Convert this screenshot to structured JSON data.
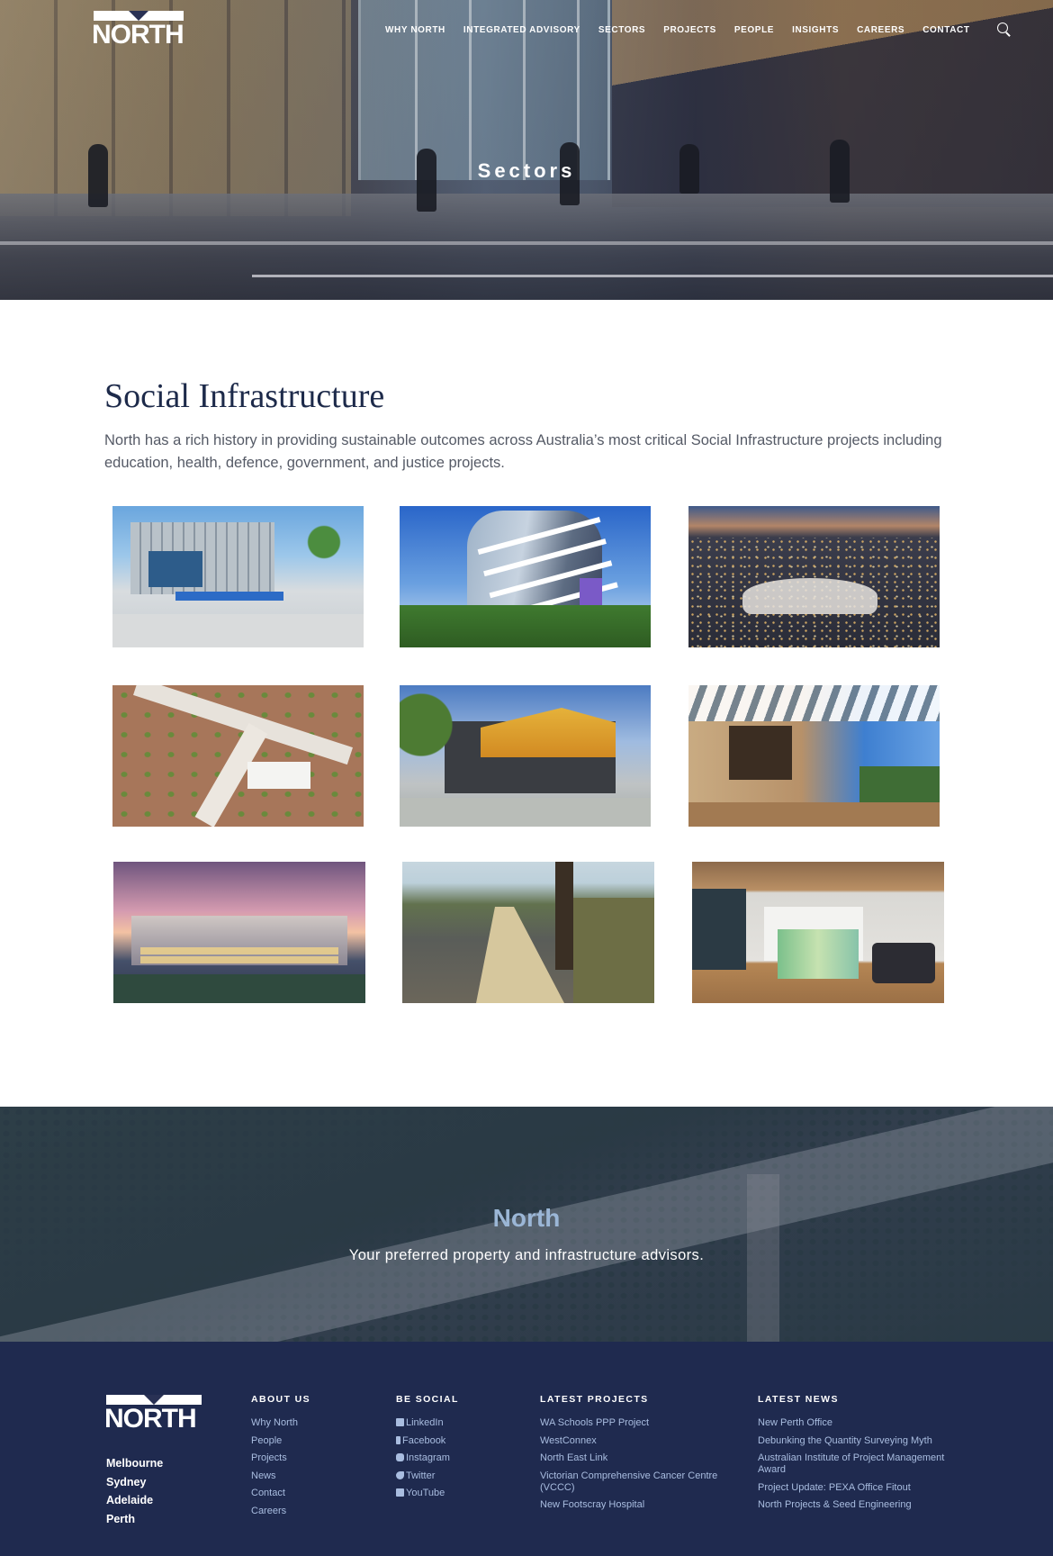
{
  "brand": {
    "logo_text": "NORTH"
  },
  "nav": {
    "items": [
      "WHY NORTH",
      "INTEGRATED ADVISORY",
      "SECTORS",
      "PROJECTS",
      "PEOPLE",
      "INSIGHTS",
      "CAREERS",
      "CONTACT"
    ],
    "search_icon": "search-icon"
  },
  "hero": {
    "title": "Sectors"
  },
  "section": {
    "title": "Social Infrastructure",
    "intro": "North has a rich history in providing sustainable outcomes across Australia’s most critical Social Infrastructure projects including education, health, defence, government, and justice projects."
  },
  "banner": {
    "title": "North",
    "subtitle": "Your preferred property and infrastructure advisors."
  },
  "footer": {
    "cities": [
      "Melbourne",
      "Sydney",
      "Adelaide",
      "Perth"
    ],
    "about": {
      "heading": "ABOUT US",
      "links": [
        "Why North",
        "People",
        "Projects",
        "News",
        "Contact",
        "Careers"
      ]
    },
    "social": {
      "heading": "BE SOCIAL",
      "links": [
        "LinkedIn",
        "Facebook",
        "Instagram",
        "Twitter",
        "YouTube"
      ]
    },
    "projects": {
      "heading": "LATEST PROJECTS",
      "links": [
        "WA Schools PPP Project",
        "WestConnex",
        "North East Link",
        "Victorian Comprehensive Cancer Centre (VCCC)",
        "New Footscray Hospital"
      ]
    },
    "news": {
      "heading": "LATEST NEWS",
      "links": [
        "New Perth Office",
        "Debunking the Quantity Surveying Myth",
        "Australian Institute of Project Management Award",
        "Project Update: PEXA Office Fitout",
        "North Projects & Seed Engineering"
      ]
    }
  },
  "colors": {
    "navy": "#1f2a4f",
    "link": "#a9bde0",
    "banner_title": "#9bb6d6"
  }
}
